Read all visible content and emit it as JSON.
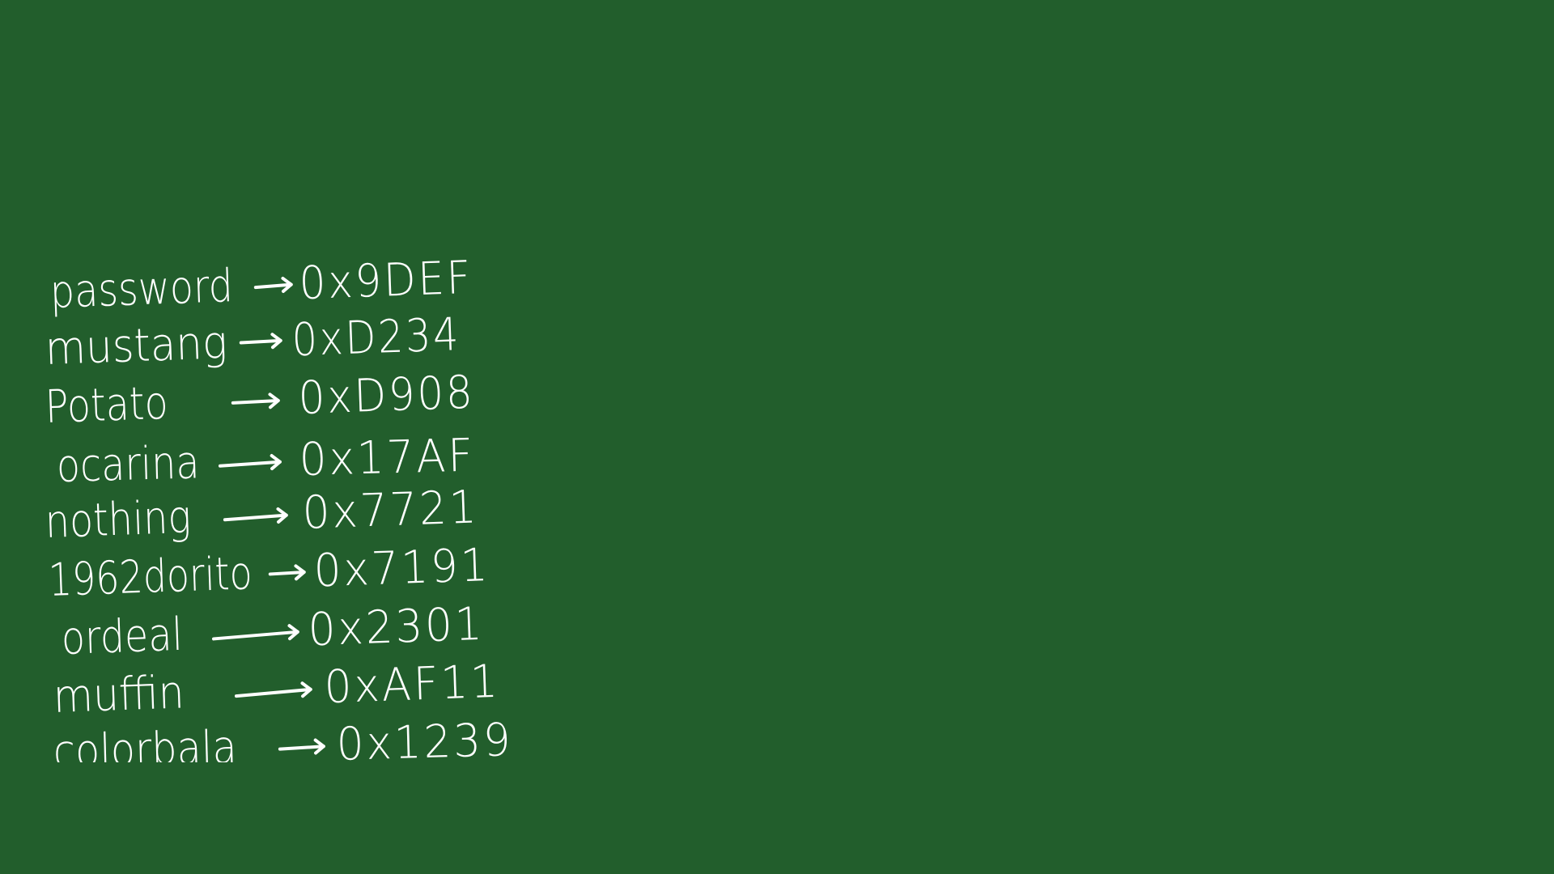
{
  "board": {
    "background_color": "#225e2c",
    "ink_color": "#ffffff",
    "entries": [
      {
        "word": "password",
        "hex": "0x9DEF"
      },
      {
        "word": "mustang",
        "hex": "0xD234"
      },
      {
        "word": "Potato",
        "hex": "0xD908"
      },
      {
        "word": "ocarina",
        "hex": "0x17AF"
      },
      {
        "word": "nothing",
        "hex": "0x7721"
      },
      {
        "word": "1962dorito",
        "hex": "0x7191"
      },
      {
        "word": "ordeal",
        "hex": "0x2301"
      },
      {
        "word": "muffin",
        "hex": "0xAF11"
      },
      {
        "word": "colorbala",
        "hex": "0x1239"
      }
    ]
  }
}
